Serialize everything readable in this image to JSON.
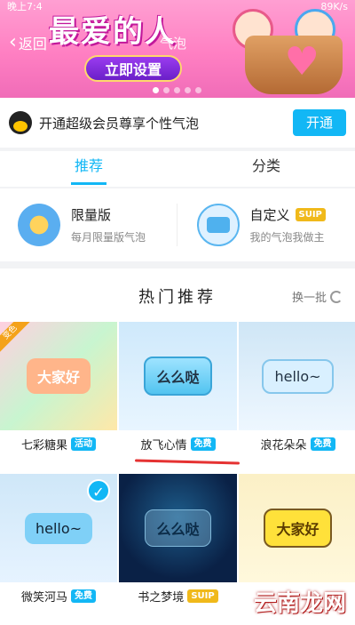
{
  "status": {
    "time": "晚上7:4",
    "speed": "89K/s"
  },
  "banner": {
    "back_label": "返回",
    "title": "气泡",
    "slogan": "最爱的人",
    "cta": "立即设置"
  },
  "vip": {
    "text": "开通超级会员尊享个性气泡",
    "button": "开通"
  },
  "tabs": [
    {
      "label": "推荐"
    },
    {
      "label": "分类"
    }
  ],
  "categories": [
    {
      "title": "限量版",
      "subtitle": "每月限量版气泡",
      "tag": ""
    },
    {
      "title": "自定义",
      "subtitle": "我的气泡我做主",
      "tag": "SUIP"
    }
  ],
  "section": {
    "title": "热门推荐",
    "refresh": "换一批"
  },
  "items": [
    {
      "name": "七彩糖果",
      "tag": "活动",
      "bubble": "大家好",
      "corner": "变色"
    },
    {
      "name": "放飞心情",
      "tag": "免费",
      "bubble": "么么哒"
    },
    {
      "name": "浪花朵朵",
      "tag": "免费",
      "bubble": "hello~"
    },
    {
      "name": "微笑河马",
      "tag": "免费",
      "bubble": "hello~"
    },
    {
      "name": "书之梦境",
      "tag": "SUIP",
      "bubble": "么么哒"
    },
    {
      "name": "",
      "tag": "",
      "bubble": "大家好"
    }
  ],
  "watermark": "云南龙网",
  "colors": {
    "accent": "#12b7f5",
    "gold": "#f0b91a"
  }
}
